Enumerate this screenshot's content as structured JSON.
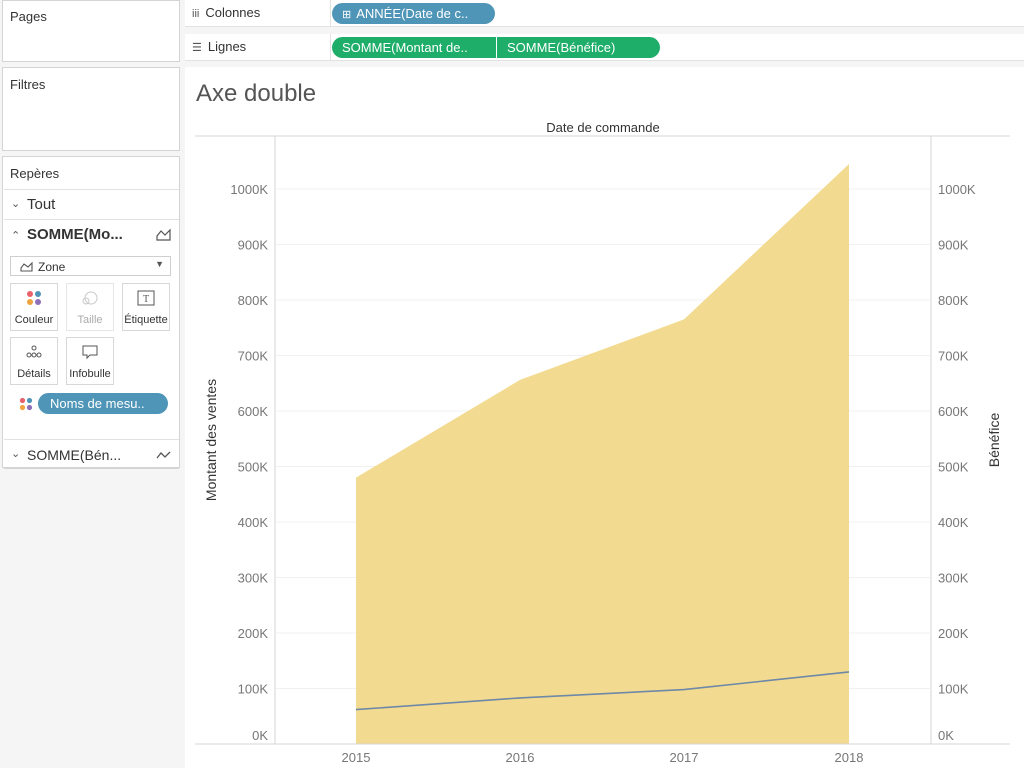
{
  "left_panel": {
    "pages_title": "Pages",
    "filters_title": "Filtres",
    "marks": {
      "title": "Repères",
      "all_label": "Tout",
      "measure1_label": "SOMME(Mo...",
      "mark_type": "Zone",
      "buttons": {
        "color": "Couleur",
        "size": "Taille",
        "label": "Étiquette",
        "detail": "Détails",
        "tooltip": "Infobulle"
      },
      "color_pill": "Noms de mesu..",
      "measure2_label": "SOMME(Bén..."
    }
  },
  "shelves": {
    "columns_label": "Colonnes",
    "columns_pill": "ANNÉE(Date de c..",
    "rows_label": "Lignes",
    "rows_pills": [
      "SOMME(Montant de..",
      "SOMME(Bénéfice)"
    ]
  },
  "colors": {
    "area_fill": "#f1d98a",
    "line": "#6e88a7",
    "pill_blue": "#4f95b7",
    "pill_green": "#1fad6a"
  },
  "chart_data": {
    "type": "area",
    "title": "Axe double",
    "header": "Date de commande",
    "x": [
      "2015",
      "2016",
      "2017",
      "2018"
    ],
    "series": [
      {
        "name": "Montant des ventes",
        "type": "area",
        "axis": "left",
        "values": [
          480000,
          656000,
          765000,
          1045000
        ]
      },
      {
        "name": "Bénéfice",
        "type": "line",
        "axis": "right",
        "values": [
          62000,
          83000,
          98000,
          130000
        ]
      }
    ],
    "ylabel": "Montant des ventes",
    "ylabel_right": "Bénéfice",
    "ylim": [
      0,
      1000000
    ],
    "yticks": [
      "0K",
      "100K",
      "200K",
      "300K",
      "400K",
      "500K",
      "600K",
      "700K",
      "800K",
      "900K",
      "1000K"
    ],
    "grid": true
  }
}
